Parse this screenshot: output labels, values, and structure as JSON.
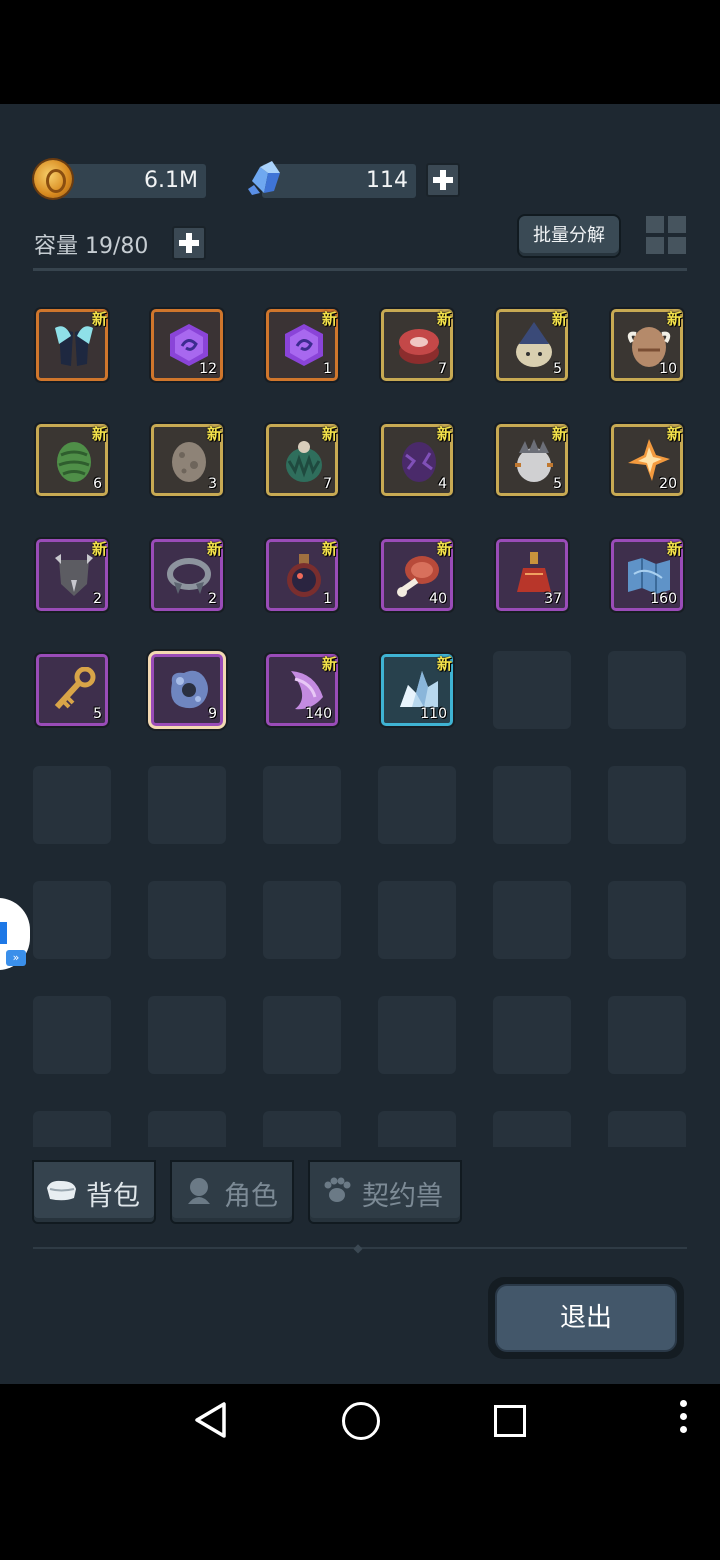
{
  "resources": {
    "gold": {
      "value": "6.1M",
      "icon": "gold-coin-icon"
    },
    "crystal": {
      "value": "114",
      "icon": "blue-crystal-icon"
    }
  },
  "inventory": {
    "capacity_label": "容量 19/80",
    "batch_button": "批量分解",
    "new_badge": "新",
    "items": [
      {
        "name": "wings-cloak",
        "frame": "orange",
        "new": true,
        "qty": ""
      },
      {
        "name": "purple-rune-stone",
        "frame": "orange",
        "new": false,
        "qty": "12"
      },
      {
        "name": "purple-rune-stone",
        "frame": "orange",
        "new": true,
        "qty": "1"
      },
      {
        "name": "raw-steak",
        "frame": "gold",
        "new": true,
        "qty": "7"
      },
      {
        "name": "wizard-egg",
        "frame": "gold",
        "new": true,
        "qty": "5"
      },
      {
        "name": "horned-egg",
        "frame": "gold",
        "new": true,
        "qty": "10"
      },
      {
        "name": "green-swirl-egg",
        "frame": "gold",
        "new": true,
        "qty": "6"
      },
      {
        "name": "stone-egg",
        "frame": "gold",
        "new": true,
        "qty": "3"
      },
      {
        "name": "leafy-egg",
        "frame": "gold",
        "new": true,
        "qty": "7"
      },
      {
        "name": "dark-purple-egg",
        "frame": "gold",
        "new": true,
        "qty": "4"
      },
      {
        "name": "spiky-grey-egg",
        "frame": "gold",
        "new": true,
        "qty": "5"
      },
      {
        "name": "orange-crystal",
        "frame": "gold",
        "new": true,
        "qty": "20"
      },
      {
        "name": "spiked-shield",
        "frame": "purple",
        "new": true,
        "qty": "2"
      },
      {
        "name": "iron-collar",
        "frame": "purple",
        "new": true,
        "qty": "2"
      },
      {
        "name": "potion-flask",
        "frame": "purple",
        "new": true,
        "qty": "1"
      },
      {
        "name": "meat-bone",
        "frame": "purple",
        "new": true,
        "qty": "40"
      },
      {
        "name": "red-elixir",
        "frame": "purple",
        "new": false,
        "qty": "37"
      },
      {
        "name": "treasure-map",
        "frame": "purple",
        "new": true,
        "qty": "160"
      },
      {
        "name": "golden-key",
        "frame": "purple",
        "new": false,
        "qty": "5"
      },
      {
        "name": "blue-ore",
        "frame": "purple",
        "new": false,
        "qty": "9",
        "selected": true
      },
      {
        "name": "purple-shard",
        "frame": "purple",
        "new": true,
        "qty": "140"
      },
      {
        "name": "ice-crystal",
        "frame": "blue",
        "new": true,
        "qty": "110"
      }
    ]
  },
  "tabs": [
    {
      "label": "背包",
      "icon": "bag-icon",
      "active": true
    },
    {
      "label": "角色",
      "icon": "character-icon",
      "active": false
    },
    {
      "label": "契约兽",
      "icon": "paw-icon",
      "active": false
    }
  ],
  "exit_button": "退出",
  "colors": {
    "panel": "#1e2831",
    "frame_orange": "#d0762c",
    "frame_gold": "#c8aa53",
    "frame_purple": "#9a4cb8",
    "frame_blue": "#3fb3d3",
    "badge_yellow": "#f2e14a"
  }
}
